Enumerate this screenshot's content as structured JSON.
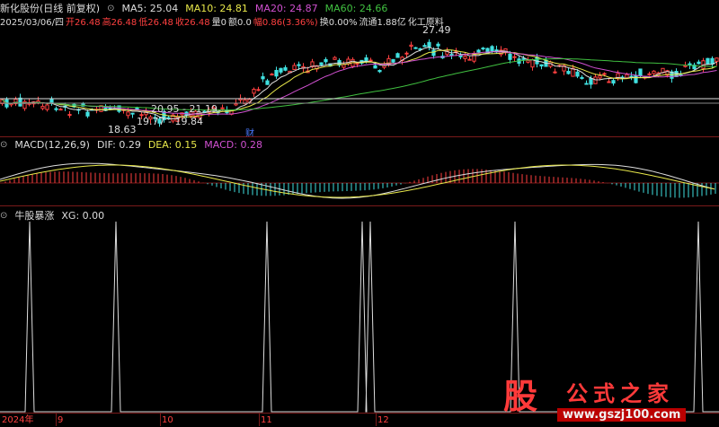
{
  "header": {
    "stock_name": "新化股份(日线 前复权)",
    "ma": [
      {
        "label": "MA5: 25.04",
        "color": "#dddddd"
      },
      {
        "label": "MA10: 24.81",
        "color": "#e8e84a"
      },
      {
        "label": "MA20: 24.87",
        "color": "#d050d0"
      },
      {
        "label": "MA60: 24.66",
        "color": "#40c040"
      }
    ],
    "bar_info": {
      "date": "2025/03/06/四",
      "open": "开26.48",
      "high": "高26.48",
      "low": "低26.48",
      "close": "收26.48",
      "volume": "量0",
      "amount": "额0.0",
      "change": "幅0.86(3.36%)",
      "turnover": "换0.00%",
      "float": "流通1.88亿",
      "sector": "化工原料"
    }
  },
  "annotations": {
    "peak": "27.49",
    "range1": "20.95 - 21.19",
    "range2": "19.77 - 19.84",
    "low": "18.63",
    "cai": "财"
  },
  "macd": {
    "title": "MACD(12,26,9)",
    "dif": "DIF: 0.29",
    "dea": "DEA: 0.15",
    "macd": "MACD: 0.28"
  },
  "xg": {
    "title": "牛股暴涨",
    "value": "XG: 0.00"
  },
  "axis": {
    "year": "2024年",
    "months": [
      "9",
      "10",
      "11",
      "12"
    ]
  },
  "logo": {
    "big": "股",
    "cn": "公式之家",
    "url": "www.gszj100.com"
  },
  "colors": {
    "up": "#ff4040",
    "down": "#40e0e0",
    "ma5": "#dddddd",
    "ma10": "#e8e84a",
    "ma20": "#d050d0",
    "ma60": "#40c040"
  }
}
